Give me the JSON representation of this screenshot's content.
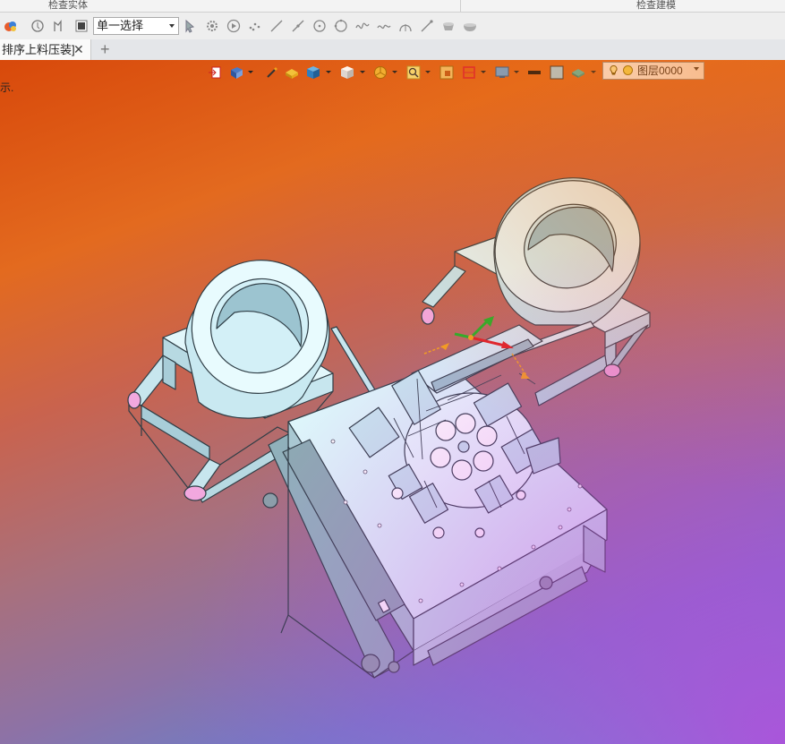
{
  "ribbon": {
    "group_left": "检查实体",
    "group_right": "检查建模"
  },
  "toolbar": {
    "selection_mode": "单一选择",
    "icons": [
      "app-icon",
      "rotate-icon",
      "select-path-icon",
      "stop-icon",
      "pointer-icon",
      "gear-point-icon",
      "play-icon",
      "points-icon",
      "line-icon",
      "line2-icon",
      "circle-center-icon",
      "circle-icon",
      "spline-icon",
      "curve-icon",
      "arc-icon",
      "trim-icon",
      "cup-icon",
      "bowl-icon"
    ]
  },
  "tabs": {
    "active_label": "排序上料压装]",
    "close_glyph": "✕",
    "new_tab_glyph": "+"
  },
  "viewport": {
    "hint_text": "示.",
    "layer_label": "图层0000"
  },
  "colors": {
    "part_fill": "#d3f0f7",
    "part_stroke": "#2f3e46",
    "foot": "#f2a8df",
    "axis_x": "#e02020",
    "axis_y": "#22b422",
    "axis_z": "#f4a21b"
  }
}
